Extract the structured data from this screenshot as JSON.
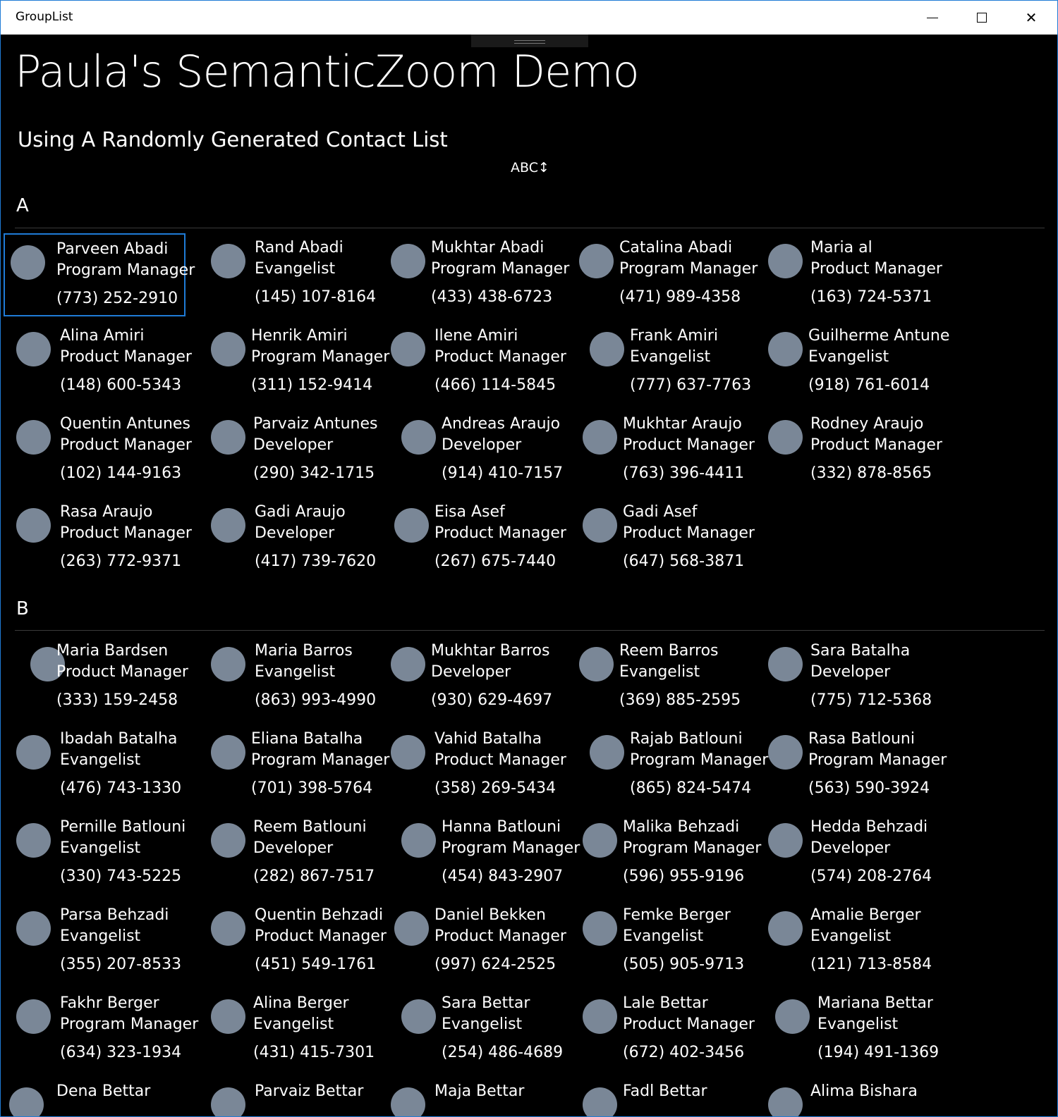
{
  "window": {
    "title": "GroupList",
    "controls": {
      "minimize": "minimize-icon",
      "maximize": "maximize-icon",
      "close": "close-icon"
    }
  },
  "header": {
    "title": "Paula's SemanticZoom Demo",
    "subtitle": "Using A Randomly Generated Contact List",
    "zoom_toggle": "ABC↕"
  },
  "colors": {
    "accent": "#1f7bd6",
    "avatar": "#7a8797",
    "background": "#000000"
  },
  "groups": [
    {
      "letter": "A",
      "contacts": [
        {
          "name": "Parveen Abadi",
          "role": "Program Manager",
          "phone": "(773) 252-2910",
          "selected": true
        },
        {
          "name": "Rand Abadi",
          "role": "Evangelist",
          "phone": "(145) 107-8164"
        },
        {
          "name": "Mukhtar Abadi",
          "role": "Program Manager",
          "phone": "(433) 438-6723"
        },
        {
          "name": "Catalina Abadi",
          "role": "Program Manager",
          "phone": "(471) 989-4358"
        },
        {
          "name": "Maria al",
          "role": "Product Manager",
          "phone": "(163) 724-5371"
        },
        {
          "name": "Alina Amiri",
          "role": "Product Manager",
          "phone": "(148) 600-5343"
        },
        {
          "name": "Henrik Amiri",
          "role": "Program Manager",
          "phone": "(311) 152-9414"
        },
        {
          "name": "Ilene Amiri",
          "role": "Product Manager",
          "phone": "(466) 114-5845"
        },
        {
          "name": "Frank Amiri",
          "role": "Evangelist",
          "phone": "(777) 637-7763"
        },
        {
          "name": "Guilherme Antune",
          "role": "Evangelist",
          "phone": "(918) 761-6014"
        },
        {
          "name": "Quentin Antunes",
          "role": "Product Manager",
          "phone": "(102) 144-9163"
        },
        {
          "name": "Parvaiz Antunes",
          "role": "Developer",
          "phone": "(290) 342-1715"
        },
        {
          "name": "Andreas Araujo",
          "role": "Developer",
          "phone": "(914) 410-7157"
        },
        {
          "name": "Mukhtar Araujo",
          "role": "Product Manager",
          "phone": "(763) 396-4411"
        },
        {
          "name": "Rodney Araujo",
          "role": "Product Manager",
          "phone": "(332) 878-8565"
        },
        {
          "name": "Rasa Araujo",
          "role": "Product Manager",
          "phone": "(263) 772-9371"
        },
        {
          "name": "Gadi Araujo",
          "role": "Developer",
          "phone": "(417) 739-7620"
        },
        {
          "name": "Eisa Asef",
          "role": "Product Manager",
          "phone": "(267) 675-7440"
        },
        {
          "name": "Gadi Asef",
          "role": "Product Manager",
          "phone": "(647) 568-3871"
        }
      ]
    },
    {
      "letter": "B",
      "contacts": [
        {
          "name": "Maria Bardsen",
          "role": "Product Manager",
          "phone": "(333) 159-2458"
        },
        {
          "name": "Maria Barros",
          "role": "Evangelist",
          "phone": "(863) 993-4990"
        },
        {
          "name": "Mukhtar Barros",
          "role": "Developer",
          "phone": "(930) 629-4697"
        },
        {
          "name": "Reem Barros",
          "role": "Evangelist",
          "phone": "(369) 885-2595"
        },
        {
          "name": "Sara Batalha",
          "role": "Developer",
          "phone": "(775) 712-5368"
        },
        {
          "name": "Ibadah Batalha",
          "role": "Evangelist",
          "phone": "(476) 743-1330"
        },
        {
          "name": "Eliana Batalha",
          "role": "Program Manager",
          "phone": "(701) 398-5764"
        },
        {
          "name": "Vahid Batalha",
          "role": "Product Manager",
          "phone": "(358) 269-5434"
        },
        {
          "name": "Rajab Batlouni",
          "role": "Program Manager",
          "phone": "(865) 824-5474"
        },
        {
          "name": "Rasa Batlouni",
          "role": "Program Manager",
          "phone": "(563) 590-3924"
        },
        {
          "name": "Pernille Batlouni",
          "role": "Evangelist",
          "phone": "(330) 743-5225"
        },
        {
          "name": "Reem Batlouni",
          "role": "Developer",
          "phone": "(282) 867-7517"
        },
        {
          "name": "Hanna Batlouni",
          "role": "Program Manager",
          "phone": "(454) 843-2907"
        },
        {
          "name": "Malika Behzadi",
          "role": "Program Manager",
          "phone": "(596) 955-9196"
        },
        {
          "name": "Hedda Behzadi",
          "role": "Developer",
          "phone": "(574) 208-2764"
        },
        {
          "name": "Parsa Behzadi",
          "role": "Evangelist",
          "phone": "(355) 207-8533"
        },
        {
          "name": "Quentin Behzadi",
          "role": "Product Manager",
          "phone": "(451) 549-1761"
        },
        {
          "name": "Daniel Bekken",
          "role": "Product Manager",
          "phone": "(997) 624-2525"
        },
        {
          "name": "Femke Berger",
          "role": "Evangelist",
          "phone": "(505) 905-9713"
        },
        {
          "name": "Amalie Berger",
          "role": "Evangelist",
          "phone": "(121) 713-8584"
        },
        {
          "name": "Fakhr Berger",
          "role": "Program Manager",
          "phone": "(634) 323-1934"
        },
        {
          "name": "Alina Berger",
          "role": "Evangelist",
          "phone": "(431) 415-7301"
        },
        {
          "name": "Sara Bettar",
          "role": "Evangelist",
          "phone": "(254) 486-4689"
        },
        {
          "name": "Lale Bettar",
          "role": "Product Manager",
          "phone": "(672) 402-3456"
        },
        {
          "name": "Mariana Bettar",
          "role": "Evangelist",
          "phone": "(194) 491-1369"
        },
        {
          "name": "Dena Bettar",
          "role": "",
          "phone": ""
        },
        {
          "name": "Parvaiz Bettar",
          "role": "",
          "phone": ""
        },
        {
          "name": "Maja Bettar",
          "role": "",
          "phone": ""
        },
        {
          "name": "Fadl Bettar",
          "role": "",
          "phone": ""
        },
        {
          "name": "Alima Bishara",
          "role": "",
          "phone": ""
        }
      ]
    }
  ]
}
